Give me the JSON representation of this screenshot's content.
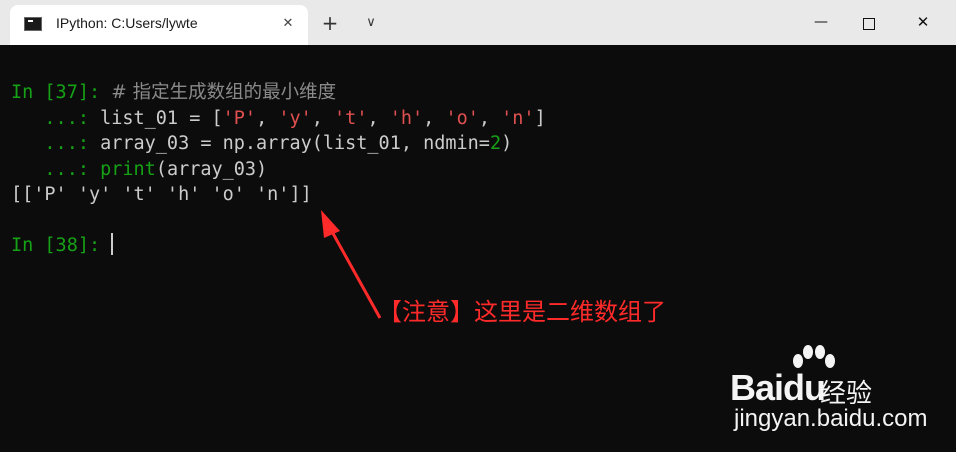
{
  "window": {
    "tab_title": "IPython: C:Users/lywte",
    "tab_close": "✕",
    "new_tab": "+",
    "dropdown": "∨",
    "minimize": "—",
    "close": "✕"
  },
  "terminal": {
    "in37_prompt": "In [37]: ",
    "comment": "# 指定生成数组的最小维度",
    "cont_prompt": "   ...: ",
    "line2_a": "list_01 = [",
    "s_P": "'P'",
    "s_y": "'y'",
    "s_t": "'t'",
    "s_h": "'h'",
    "s_o": "'o'",
    "s_n": "'n'",
    "comma": ", ",
    "close_bracket": "]",
    "line3_a": "array_03 = np.array(list_01, ndmin=",
    "num_2": "2",
    "paren_close": ")",
    "print_kw": "print",
    "line4_rest": "(array_03)",
    "output": "[['P' 'y' 't' 'h' 'o' 'n']]",
    "in38_prompt": "In [38]: "
  },
  "annotation": {
    "text": "【注意】这里是二维数组了",
    "color": "#ff2a2a"
  },
  "watermark": {
    "brand": "Bai",
    "du": "du",
    "jingyan": "经验",
    "url": "jingyan.baidu.com"
  },
  "colors": {
    "prompt": "#16a116",
    "string": "#e05050",
    "comment": "#8a8a8a",
    "text": "#cccccc",
    "background": "#0c0c0c"
  }
}
